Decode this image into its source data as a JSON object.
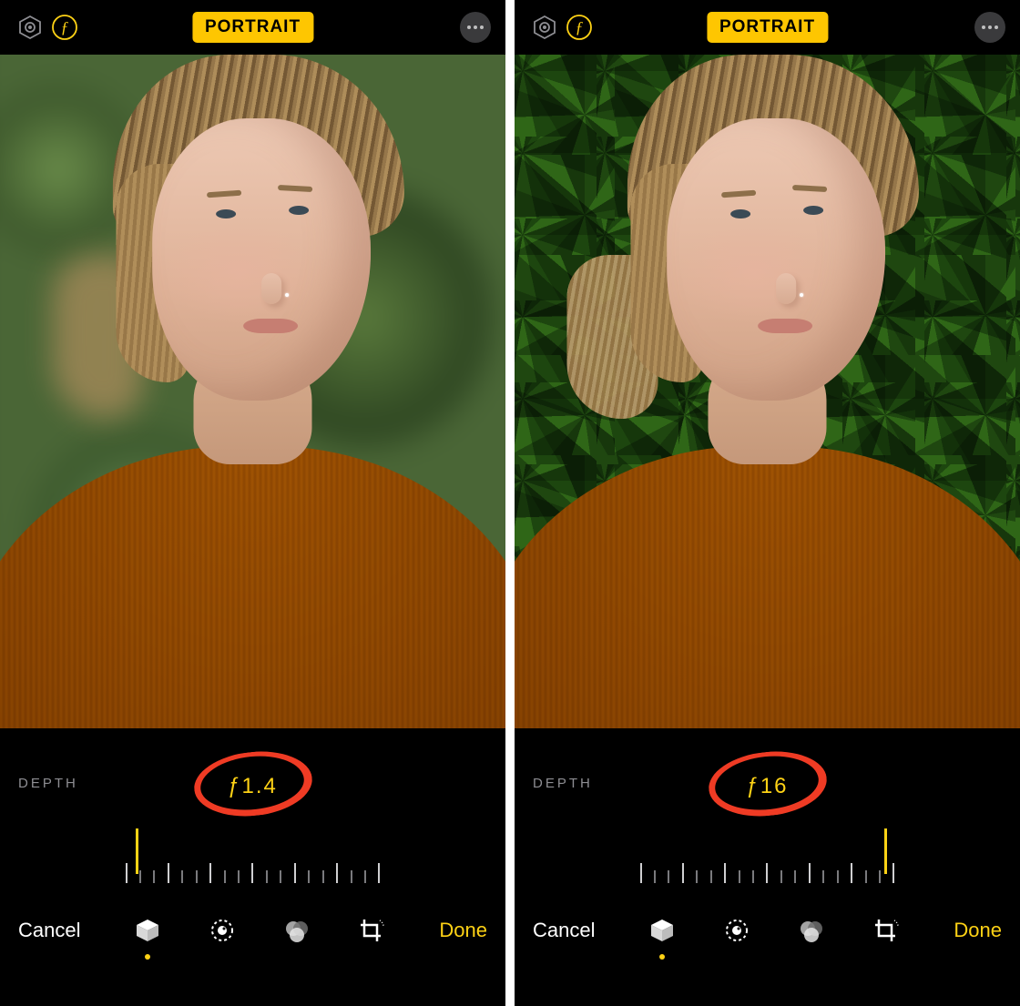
{
  "panes": [
    {
      "header": {
        "mode": "PORTRAIT",
        "aperture_icon": "ƒ"
      },
      "depth_label": "DEPTH",
      "f_value": "ƒ1.4",
      "slider_position_pct": 4,
      "background_blurred": true,
      "toolbar": {
        "cancel": "Cancel",
        "done": "Done"
      },
      "icons": {
        "hex": "hexagon-icon",
        "aperture": "aperture-icon",
        "more": "more-icon",
        "cube": "cube-icon",
        "adjust": "adjust-icon",
        "filters": "filters-icon",
        "crop": "crop-icon"
      }
    },
    {
      "header": {
        "mode": "PORTRAIT",
        "aperture_icon": "ƒ"
      },
      "depth_label": "DEPTH",
      "f_value": "ƒ16",
      "slider_position_pct": 96,
      "background_blurred": false,
      "toolbar": {
        "cancel": "Cancel",
        "done": "Done"
      },
      "icons": {
        "hex": "hexagon-icon",
        "aperture": "aperture-icon",
        "more": "more-icon",
        "cube": "cube-icon",
        "adjust": "adjust-icon",
        "filters": "filters-icon",
        "crop": "crop-icon"
      }
    }
  ],
  "annotation": {
    "type": "red-circle",
    "target": "f_value"
  },
  "colors": {
    "accent": "#fed215",
    "annotation_red": "#ef3b24",
    "muted_text": "#8e8e93"
  }
}
